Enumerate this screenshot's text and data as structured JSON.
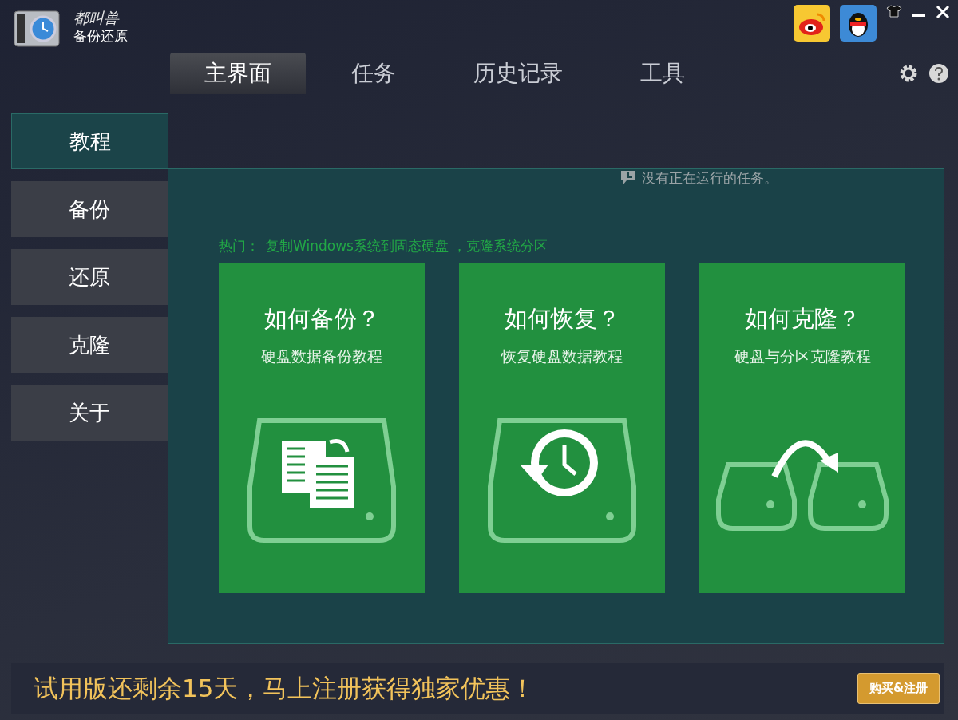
{
  "app": {
    "brand": "都叫兽",
    "name": "备份还原"
  },
  "tabs": [
    {
      "label": "主界面",
      "selected": true
    },
    {
      "label": "任务",
      "selected": false
    },
    {
      "label": "历史记录",
      "selected": false
    },
    {
      "label": "工具",
      "selected": false
    }
  ],
  "sidebar": {
    "items": [
      {
        "label": "教程",
        "selected": true
      },
      {
        "label": "备份",
        "selected": false
      },
      {
        "label": "还原",
        "selected": false
      },
      {
        "label": "克隆",
        "selected": false
      },
      {
        "label": "关于",
        "selected": false
      }
    ]
  },
  "status": "没有正在运行的任务。",
  "hot": {
    "label": "热门：",
    "link": "复制Windows系统到固态硬盘 ，克隆系统分区"
  },
  "cards": [
    {
      "kind": "backup",
      "title": "如何备份？",
      "subtitle": "硬盘数据备份教程"
    },
    {
      "kind": "restore",
      "title": "如何恢复？",
      "subtitle": "恢复硬盘数据教程"
    },
    {
      "kind": "clone",
      "title": "如何克隆？",
      "subtitle": "硬盘与分区克隆教程"
    }
  ],
  "footer": {
    "message": "试用版还剩余15天，马上注册获得独家优惠！",
    "button": "购买&注册"
  }
}
